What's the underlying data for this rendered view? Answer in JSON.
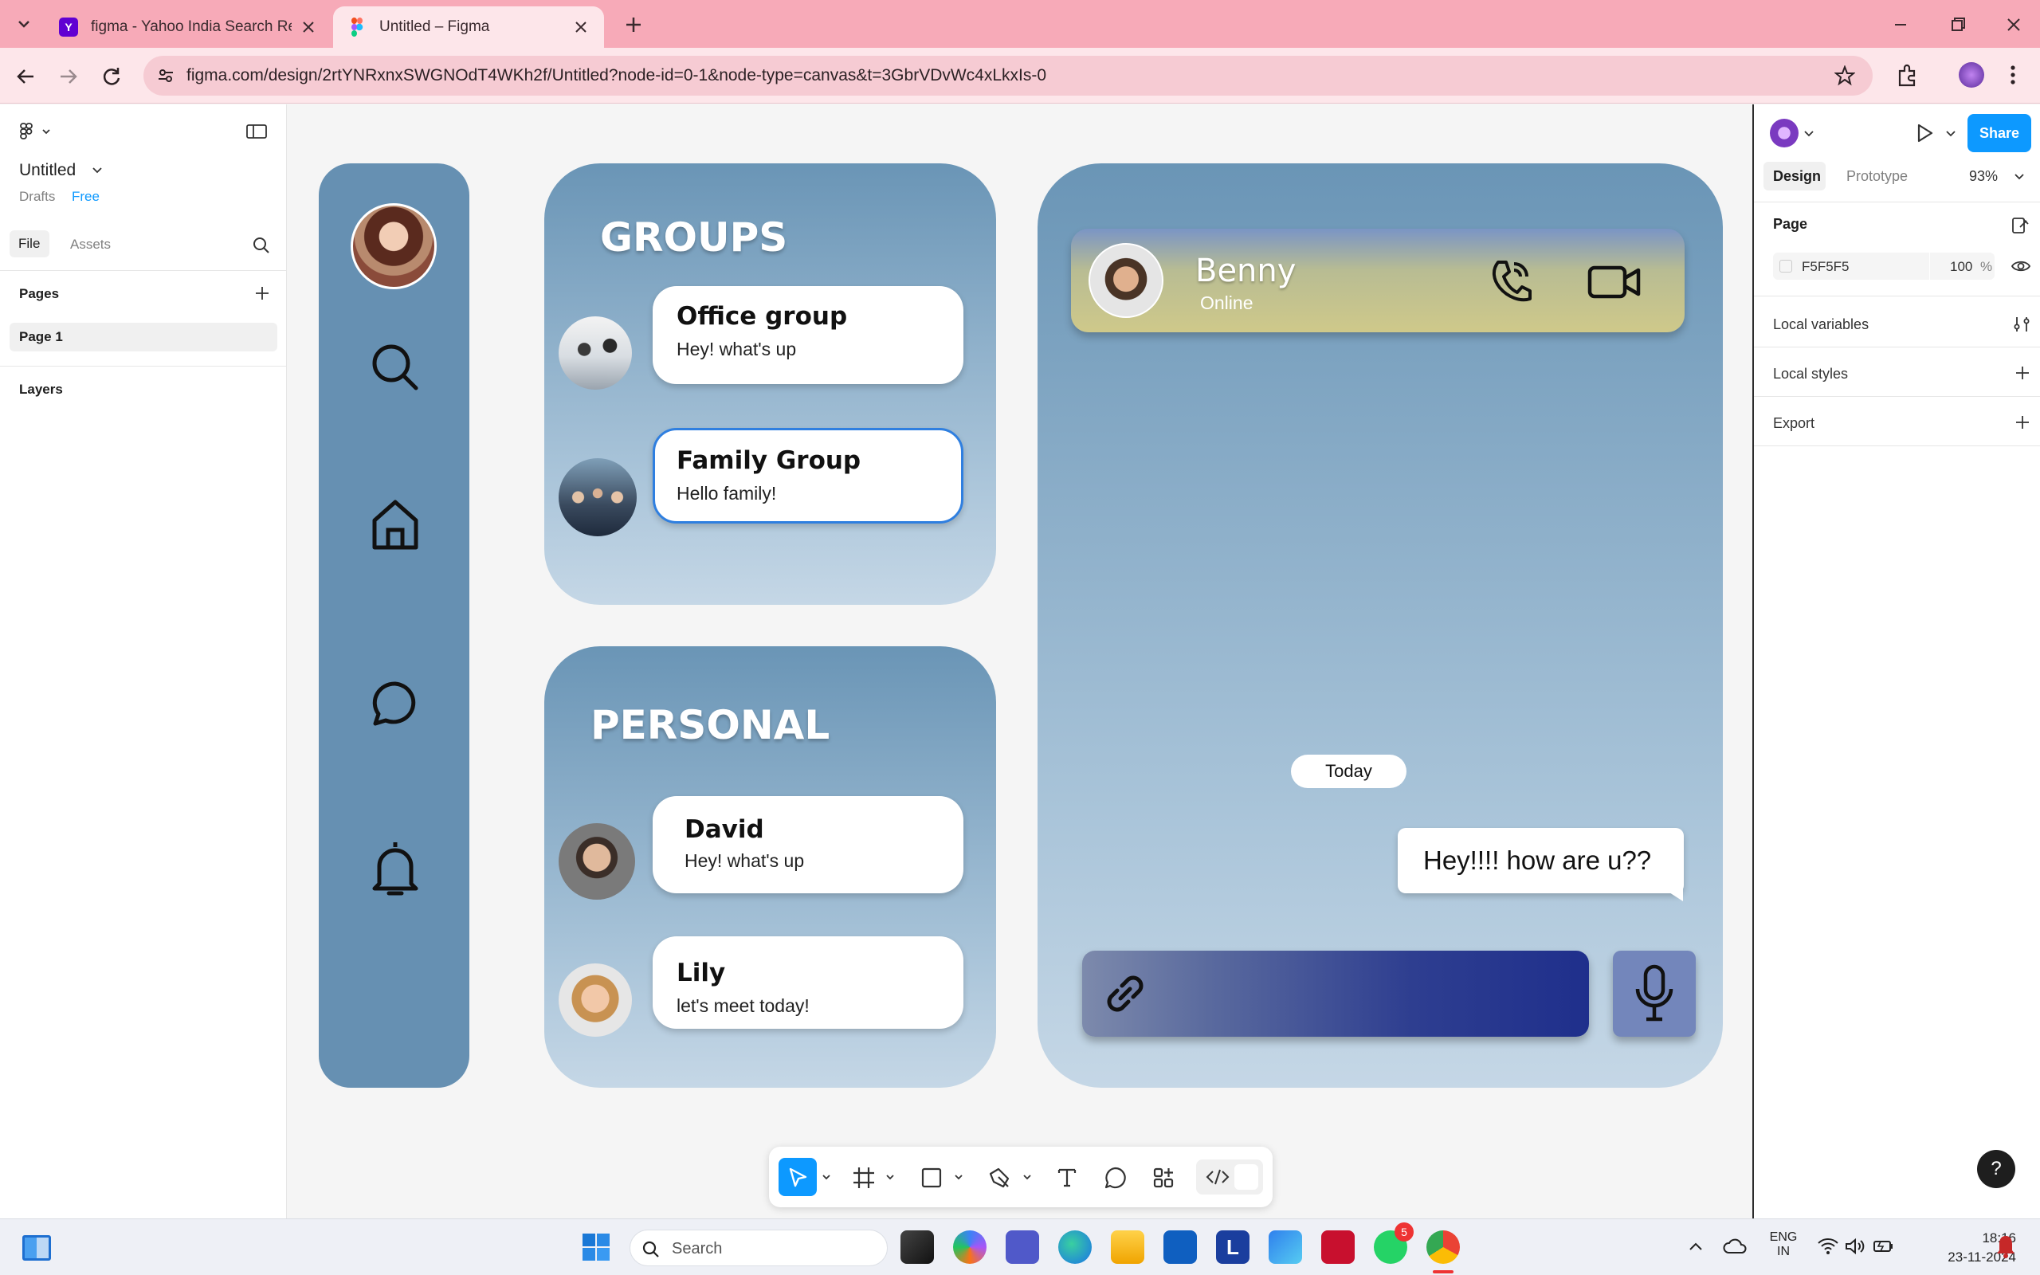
{
  "browser": {
    "tabs": [
      {
        "title": "figma - Yahoo India Search Resu",
        "icon": "yahoo-icon"
      },
      {
        "title": "Untitled – Figma",
        "icon": "figma-icon"
      }
    ],
    "url": "figma.com/design/2rtYNRxnxSWGNOdT4WKh2f/Untitled?node-id=0-1&node-type=canvas&t=3GbrVDvWc4xLkxIs-0"
  },
  "figma_left": {
    "file_title": "Untitled",
    "drafts": "Drafts",
    "plan": "Free",
    "tab_file": "File",
    "tab_assets": "Assets",
    "pages_heading": "Pages",
    "page_item": "Page 1",
    "layers_heading": "Layers"
  },
  "figma_right": {
    "tab_design": "Design",
    "tab_prototype": "Prototype",
    "zoom": "93%",
    "share": "Share",
    "page_heading": "Page",
    "bg_hex": "F5F5F5",
    "bg_opacity": "100",
    "percent": "%",
    "local_variables": "Local variables",
    "local_styles": "Local styles",
    "export": "Export",
    "help": "?"
  },
  "design": {
    "groups_title": "GROUPS",
    "groups": [
      {
        "name": "Office group",
        "message": "Hey! what's up"
      },
      {
        "name": "Family Group",
        "message": "Hello family!"
      }
    ],
    "personal_title": "PERSONAL",
    "personal": [
      {
        "name": "David",
        "message": "Hey! what's up"
      },
      {
        "name": "Lily",
        "message": "let's meet today!"
      }
    ],
    "chat": {
      "contact_name": "Benny",
      "status": "Online",
      "date_chip": "Today",
      "message": "Hey!!!! how are u??"
    }
  },
  "taskbar": {
    "search_placeholder": "Search",
    "lang_top": "ENG",
    "lang_bottom": "IN",
    "time": "18:16",
    "date": "23-11-2024",
    "whatsapp_badge": "5"
  },
  "colors": {
    "tabbar": "#f7aab8",
    "figma_blue": "#0d99ff",
    "card_top": "#6a95b6",
    "card_bottom": "#c5d7e6",
    "header_chat": "#c8c48a",
    "input_dark": "#1f2f8c"
  }
}
